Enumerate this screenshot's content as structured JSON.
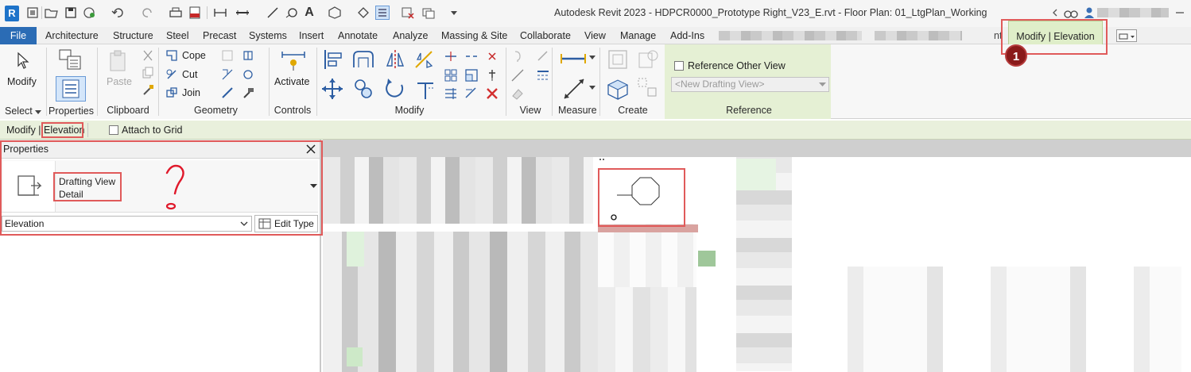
{
  "window": {
    "title": "Autodesk Revit 2023 - HDPCR0000_Prototype Right_V23_E.rvt - Floor Plan: 01_LtgPlan_Working"
  },
  "ribbon_tabs": [
    {
      "label": "File"
    },
    {
      "label": "Architecture"
    },
    {
      "label": "Structure"
    },
    {
      "label": "Steel"
    },
    {
      "label": "Precast"
    },
    {
      "label": "Systems"
    },
    {
      "label": "Insert"
    },
    {
      "label": "Annotate"
    },
    {
      "label": "Analyze"
    },
    {
      "label": "Massing & Site"
    },
    {
      "label": "Collaborate"
    },
    {
      "label": "View"
    },
    {
      "label": "Manage"
    },
    {
      "label": "Add-Ins"
    }
  ],
  "context_tab": {
    "label": "Modify | Elevation",
    "partial_left": "nt"
  },
  "ribbon": {
    "modify": {
      "label": "Modify"
    },
    "clipboard": {
      "paste": "Paste"
    },
    "geometry": {
      "cope": "Cope",
      "cut": "Cut",
      "join": "Join"
    },
    "controls": {
      "activate": "Activate"
    },
    "reference": {
      "checkbox_label": "Reference Other View",
      "dropdown_value": "<New Drafting View>"
    },
    "panels": {
      "select": "Select",
      "properties": "Properties",
      "clipboard": "Clipboard",
      "geometry": "Geometry",
      "controls": "Controls",
      "modify": "Modify",
      "view": "View",
      "measure": "Measure",
      "create": "Create",
      "reference": "Reference"
    }
  },
  "options_bar": {
    "context_prefix": "Modify |",
    "context_name": "Elevation",
    "attach_to_grid": "Attach to Grid"
  },
  "properties_palette": {
    "title": "Properties",
    "type_family": "Drafting View",
    "type_name": "Detail",
    "instance_filter": "Elevation",
    "edit_type": "Edit Type"
  },
  "annotations": {
    "step_number": "1",
    "question_mark": "?"
  },
  "colors": {
    "accent_blue": "#2b6cb5",
    "context_green": "#dfeec9",
    "options_bar_green": "#e9f0dc",
    "annotation_red": "#e05a5a",
    "badge_red": "#8a1a1a"
  }
}
